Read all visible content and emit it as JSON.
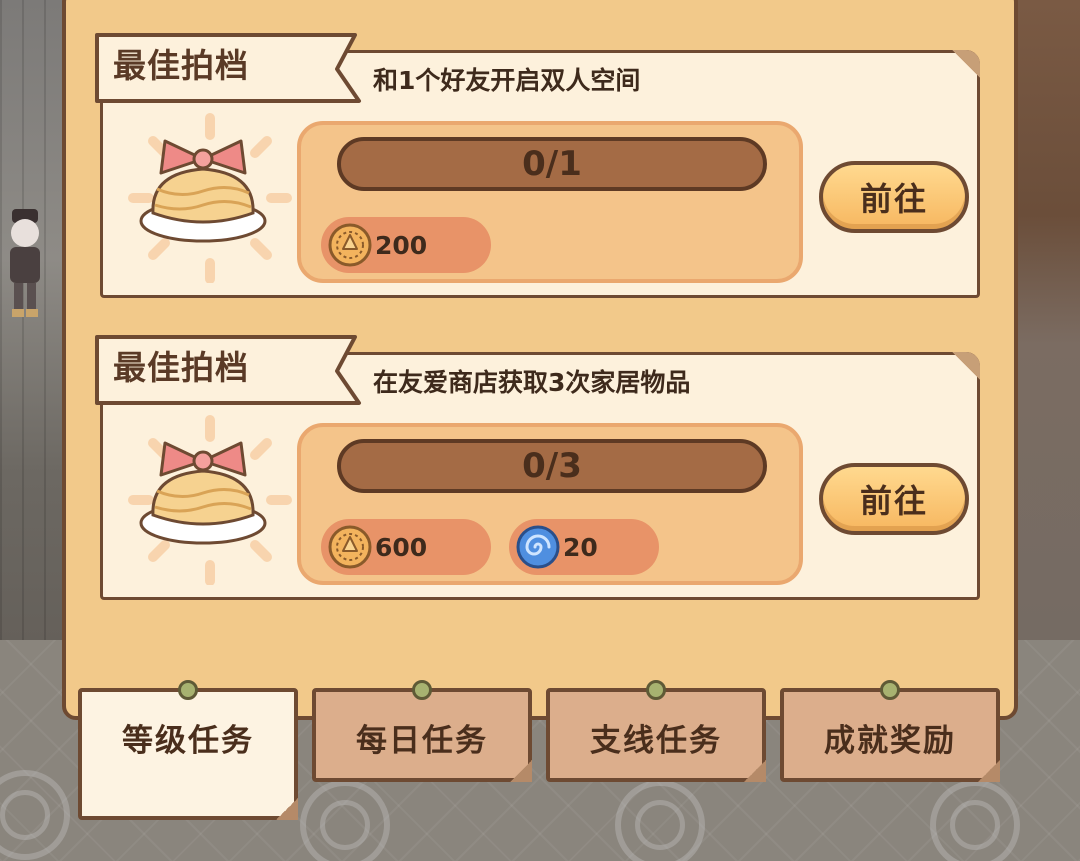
{
  "tasks": [
    {
      "title": "最佳拍档",
      "description": "和1个好友开启双人空间",
      "progress_text": "0/1",
      "progress": 0,
      "rewards": [
        {
          "icon": "gold-coin-icon",
          "amount": "200"
        }
      ],
      "go_label": "前往"
    },
    {
      "title": "最佳拍档",
      "description": "在友爱商店获取3次家居物品",
      "progress_text": "0/3",
      "progress": 0,
      "rewards": [
        {
          "icon": "gold-coin-icon",
          "amount": "600"
        },
        {
          "icon": "blue-swirl-icon",
          "amount": "20"
        }
      ],
      "go_label": "前往"
    }
  ],
  "tabs": [
    {
      "label": "等级任务",
      "active": true
    },
    {
      "label": "每日任务",
      "active": false
    },
    {
      "label": "支线任务",
      "active": false
    },
    {
      "label": "成就奖励",
      "active": false
    }
  ],
  "colors": {
    "panel": "#f2c98a",
    "card": "#fdf1dc",
    "outline": "#6e4a32",
    "bar_track": "#a46b45",
    "reward_pill": "#e89368",
    "button": "#f7b760"
  }
}
